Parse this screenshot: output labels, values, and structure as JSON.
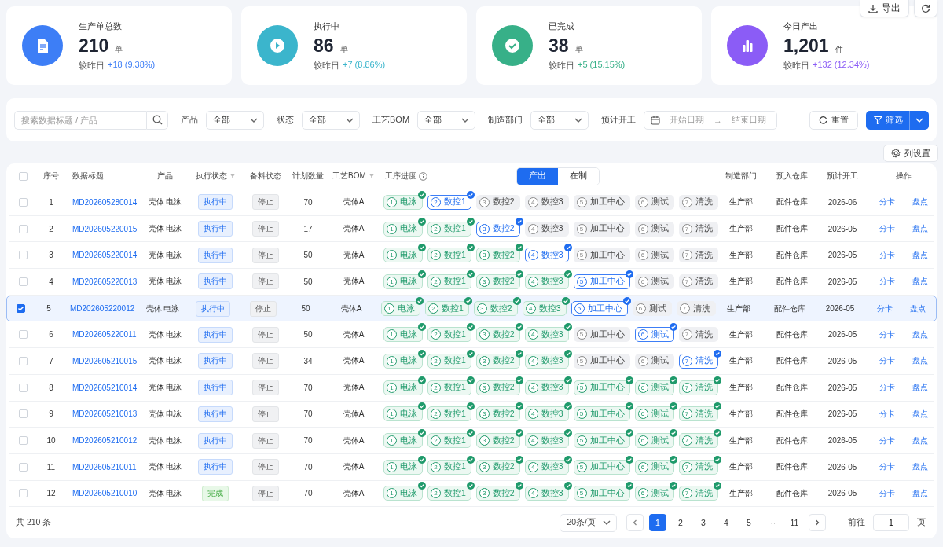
{
  "toolbar": {
    "export": "导出"
  },
  "stats": [
    {
      "label": "生产单总数",
      "value": "210",
      "unit": "单",
      "compare_label": "较昨日",
      "delta": "+18 (9.38%)",
      "color": "#3d7ef6",
      "kind": "document"
    },
    {
      "label": "执行中",
      "value": "86",
      "unit": "单",
      "compare_label": "较昨日",
      "delta": "+7 (8.86%)",
      "color": "#3bb5cc",
      "kind": "play"
    },
    {
      "label": "已完成",
      "value": "38",
      "unit": "单",
      "compare_label": "较昨日",
      "delta": "+5 (15.15%)",
      "color": "#37b088",
      "kind": "check"
    },
    {
      "label": "今日产出",
      "value": "1,201",
      "unit": "件",
      "compare_label": "较昨日",
      "delta": "+132 (12.34%)",
      "color": "#8b5cf6",
      "kind": "chart"
    }
  ],
  "filters": {
    "search": {
      "placeholder": "搜索数据标题 / 产品"
    },
    "selects": [
      {
        "label": "产品",
        "value": "全部"
      },
      {
        "label": "状态",
        "value": "全部"
      },
      {
        "label": "工艺BOM",
        "value": "全部"
      },
      {
        "label": "制造部门",
        "value": "全部"
      }
    ],
    "date": {
      "label": "预计开工",
      "start_placeholder": "开始日期",
      "arrow": "→",
      "end_placeholder": "结束日期"
    },
    "reset": "重置",
    "filter": "筛选"
  },
  "column_settings": "列设置",
  "table": {
    "all_checked": false,
    "columns": [
      {
        "label": "序号"
      },
      {
        "label": "数据标题"
      },
      {
        "label": "产品"
      },
      {
        "label": "执行状态",
        "kind": "filter"
      },
      {
        "label": "备料状态"
      },
      {
        "label": "计划数量"
      },
      {
        "label": "工艺BOM",
        "kind": "filter"
      },
      {
        "label": "工序进度",
        "kind": "info"
      },
      {
        "label": "制造部门"
      },
      {
        "label": "预入仓库"
      },
      {
        "label": "预计开工"
      },
      {
        "label": "操作"
      }
    ],
    "progress_tabs": [
      {
        "label": "产出",
        "selected": true
      },
      {
        "label": "在制",
        "selected": false
      }
    ],
    "rows": [
      {
        "selected": false,
        "no": "1",
        "title": "MD202605280014",
        "product": "壳体 电泳",
        "exec_status": {
          "label": "执行中",
          "kind": "running"
        },
        "material_status": "停止",
        "qty": "70",
        "bom": "壳体A",
        "steps": [
          {
            "no": "1",
            "label": "电泳",
            "kind": "done"
          },
          {
            "no": "2",
            "label": "数控1",
            "kind": "current"
          },
          {
            "no": "3",
            "label": "数控2",
            "kind": "pending"
          },
          {
            "no": "4",
            "label": "数控3",
            "kind": "pending"
          },
          {
            "no": "5",
            "label": "加工中心",
            "kind": "pending"
          },
          {
            "no": "6",
            "label": "测试",
            "kind": "pending"
          },
          {
            "no": "7",
            "label": "清洗",
            "kind": "pending"
          }
        ],
        "dept": "生产部",
        "warehouse": "配件仓库",
        "start": "2026-06",
        "actions": [
          "分卡",
          "盘点"
        ]
      },
      {
        "selected": false,
        "no": "2",
        "title": "MD202605220015",
        "product": "壳体 电泳",
        "exec_status": {
          "label": "执行中",
          "kind": "running"
        },
        "material_status": "停止",
        "qty": "17",
        "bom": "壳体A",
        "steps": [
          {
            "no": "1",
            "label": "电泳",
            "kind": "done"
          },
          {
            "no": "2",
            "label": "数控1",
            "kind": "done"
          },
          {
            "no": "3",
            "label": "数控2",
            "kind": "current"
          },
          {
            "no": "4",
            "label": "数控3",
            "kind": "pending"
          },
          {
            "no": "5",
            "label": "加工中心",
            "kind": "pending"
          },
          {
            "no": "6",
            "label": "测试",
            "kind": "pending"
          },
          {
            "no": "7",
            "label": "清洗",
            "kind": "pending"
          }
        ],
        "dept": "生产部",
        "warehouse": "配件仓库",
        "start": "2026-05",
        "actions": [
          "分卡",
          "盘点"
        ]
      },
      {
        "selected": false,
        "no": "3",
        "title": "MD202605220014",
        "product": "壳体 电泳",
        "exec_status": {
          "label": "执行中",
          "kind": "running"
        },
        "material_status": "停止",
        "qty": "50",
        "bom": "壳体A",
        "steps": [
          {
            "no": "1",
            "label": "电泳",
            "kind": "done"
          },
          {
            "no": "2",
            "label": "数控1",
            "kind": "done"
          },
          {
            "no": "3",
            "label": "数控2",
            "kind": "done"
          },
          {
            "no": "4",
            "label": "数控3",
            "kind": "current"
          },
          {
            "no": "5",
            "label": "加工中心",
            "kind": "pending"
          },
          {
            "no": "6",
            "label": "测试",
            "kind": "pending"
          },
          {
            "no": "7",
            "label": "清洗",
            "kind": "pending"
          }
        ],
        "dept": "生产部",
        "warehouse": "配件仓库",
        "start": "2026-05",
        "actions": [
          "分卡",
          "盘点"
        ]
      },
      {
        "selected": false,
        "no": "4",
        "title": "MD202605220013",
        "product": "壳体 电泳",
        "exec_status": {
          "label": "执行中",
          "kind": "running"
        },
        "material_status": "停止",
        "qty": "50",
        "bom": "壳体A",
        "steps": [
          {
            "no": "1",
            "label": "电泳",
            "kind": "done"
          },
          {
            "no": "2",
            "label": "数控1",
            "kind": "done"
          },
          {
            "no": "3",
            "label": "数控2",
            "kind": "done"
          },
          {
            "no": "4",
            "label": "数控3",
            "kind": "done"
          },
          {
            "no": "5",
            "label": "加工中心",
            "kind": "current"
          },
          {
            "no": "6",
            "label": "测试",
            "kind": "pending"
          },
          {
            "no": "7",
            "label": "清洗",
            "kind": "pending"
          }
        ],
        "dept": "生产部",
        "warehouse": "配件仓库",
        "start": "2026-05",
        "actions": [
          "分卡",
          "盘点"
        ]
      },
      {
        "selected": true,
        "no": "5",
        "title": "MD202605220012",
        "product": "壳体 电泳",
        "exec_status": {
          "label": "执行中",
          "kind": "running"
        },
        "material_status": "停止",
        "qty": "50",
        "bom": "壳体A",
        "steps": [
          {
            "no": "1",
            "label": "电泳",
            "kind": "done"
          },
          {
            "no": "2",
            "label": "数控1",
            "kind": "done"
          },
          {
            "no": "3",
            "label": "数控2",
            "kind": "done"
          },
          {
            "no": "4",
            "label": "数控3",
            "kind": "done"
          },
          {
            "no": "5",
            "label": "加工中心",
            "kind": "current"
          },
          {
            "no": "6",
            "label": "测试",
            "kind": "pending"
          },
          {
            "no": "7",
            "label": "清洗",
            "kind": "pending"
          }
        ],
        "dept": "生产部",
        "warehouse": "配件仓库",
        "start": "2026-05",
        "actions": [
          "分卡",
          "盘点"
        ]
      },
      {
        "selected": false,
        "no": "6",
        "title": "MD202605220011",
        "product": "壳体 电泳",
        "exec_status": {
          "label": "执行中",
          "kind": "running"
        },
        "material_status": "停止",
        "qty": "50",
        "bom": "壳体A",
        "steps": [
          {
            "no": "1",
            "label": "电泳",
            "kind": "done"
          },
          {
            "no": "2",
            "label": "数控1",
            "kind": "done"
          },
          {
            "no": "3",
            "label": "数控2",
            "kind": "done"
          },
          {
            "no": "4",
            "label": "数控3",
            "kind": "done"
          },
          {
            "no": "5",
            "label": "加工中心",
            "kind": "pending"
          },
          {
            "no": "6",
            "label": "测试",
            "kind": "current"
          },
          {
            "no": "7",
            "label": "清洗",
            "kind": "pending"
          }
        ],
        "dept": "生产部",
        "warehouse": "配件仓库",
        "start": "2026-05",
        "actions": [
          "分卡",
          "盘点"
        ]
      },
      {
        "selected": false,
        "no": "7",
        "title": "MD202605210015",
        "product": "壳体 电泳",
        "exec_status": {
          "label": "执行中",
          "kind": "running"
        },
        "material_status": "停止",
        "qty": "34",
        "bom": "壳体A",
        "steps": [
          {
            "no": "1",
            "label": "电泳",
            "kind": "done"
          },
          {
            "no": "2",
            "label": "数控1",
            "kind": "done"
          },
          {
            "no": "3",
            "label": "数控2",
            "kind": "done"
          },
          {
            "no": "4",
            "label": "数控3",
            "kind": "done"
          },
          {
            "no": "5",
            "label": "加工中心",
            "kind": "pending"
          },
          {
            "no": "6",
            "label": "测试",
            "kind": "pending"
          },
          {
            "no": "7",
            "label": "清洗",
            "kind": "current"
          }
        ],
        "dept": "生产部",
        "warehouse": "配件仓库",
        "start": "2026-05",
        "actions": [
          "分卡",
          "盘点"
        ]
      },
      {
        "selected": false,
        "no": "8",
        "title": "MD202605210014",
        "product": "壳体 电泳",
        "exec_status": {
          "label": "执行中",
          "kind": "running"
        },
        "material_status": "停止",
        "qty": "70",
        "bom": "壳体A",
        "steps": [
          {
            "no": "1",
            "label": "电泳",
            "kind": "done"
          },
          {
            "no": "2",
            "label": "数控1",
            "kind": "done"
          },
          {
            "no": "3",
            "label": "数控2",
            "kind": "done"
          },
          {
            "no": "4",
            "label": "数控3",
            "kind": "done"
          },
          {
            "no": "5",
            "label": "加工中心",
            "kind": "done"
          },
          {
            "no": "6",
            "label": "测试",
            "kind": "done"
          },
          {
            "no": "7",
            "label": "清洗",
            "kind": "done"
          }
        ],
        "dept": "生产部",
        "warehouse": "配件仓库",
        "start": "2026-05",
        "actions": [
          "分卡",
          "盘点"
        ]
      },
      {
        "selected": false,
        "no": "9",
        "title": "MD202605210013",
        "product": "壳体 电泳",
        "exec_status": {
          "label": "执行中",
          "kind": "running"
        },
        "material_status": "停止",
        "qty": "70",
        "bom": "壳体A",
        "steps": [
          {
            "no": "1",
            "label": "电泳",
            "kind": "done"
          },
          {
            "no": "2",
            "label": "数控1",
            "kind": "done"
          },
          {
            "no": "3",
            "label": "数控2",
            "kind": "done"
          },
          {
            "no": "4",
            "label": "数控3",
            "kind": "done"
          },
          {
            "no": "5",
            "label": "加工中心",
            "kind": "done"
          },
          {
            "no": "6",
            "label": "测试",
            "kind": "done"
          },
          {
            "no": "7",
            "label": "清洗",
            "kind": "done"
          }
        ],
        "dept": "生产部",
        "warehouse": "配件仓库",
        "start": "2026-05",
        "actions": [
          "分卡",
          "盘点"
        ]
      },
      {
        "selected": false,
        "no": "10",
        "title": "MD202605210012",
        "product": "壳体 电泳",
        "exec_status": {
          "label": "执行中",
          "kind": "running"
        },
        "material_status": "停止",
        "qty": "70",
        "bom": "壳体A",
        "steps": [
          {
            "no": "1",
            "label": "电泳",
            "kind": "done"
          },
          {
            "no": "2",
            "label": "数控1",
            "kind": "done"
          },
          {
            "no": "3",
            "label": "数控2",
            "kind": "done"
          },
          {
            "no": "4",
            "label": "数控3",
            "kind": "done"
          },
          {
            "no": "5",
            "label": "加工中心",
            "kind": "done"
          },
          {
            "no": "6",
            "label": "测试",
            "kind": "done"
          },
          {
            "no": "7",
            "label": "清洗",
            "kind": "done"
          }
        ],
        "dept": "生产部",
        "warehouse": "配件仓库",
        "start": "2026-05",
        "actions": [
          "分卡",
          "盘点"
        ]
      },
      {
        "selected": false,
        "no": "11",
        "title": "MD202605210011",
        "product": "壳体 电泳",
        "exec_status": {
          "label": "执行中",
          "kind": "running"
        },
        "material_status": "停止",
        "qty": "70",
        "bom": "壳体A",
        "steps": [
          {
            "no": "1",
            "label": "电泳",
            "kind": "done"
          },
          {
            "no": "2",
            "label": "数控1",
            "kind": "done"
          },
          {
            "no": "3",
            "label": "数控2",
            "kind": "done"
          },
          {
            "no": "4",
            "label": "数控3",
            "kind": "done"
          },
          {
            "no": "5",
            "label": "加工中心",
            "kind": "done"
          },
          {
            "no": "6",
            "label": "测试",
            "kind": "done"
          },
          {
            "no": "7",
            "label": "清洗",
            "kind": "done"
          }
        ],
        "dept": "生产部",
        "warehouse": "配件仓库",
        "start": "2026-05",
        "actions": [
          "分卡",
          "盘点"
        ]
      },
      {
        "selected": false,
        "no": "12",
        "title": "MD202605210010",
        "product": "壳体 电泳",
        "exec_status": {
          "label": "完成",
          "kind": "done"
        },
        "material_status": "停止",
        "qty": "70",
        "bom": "壳体A",
        "steps": [
          {
            "no": "1",
            "label": "电泳",
            "kind": "done"
          },
          {
            "no": "2",
            "label": "数控1",
            "kind": "done"
          },
          {
            "no": "3",
            "label": "数控2",
            "kind": "done"
          },
          {
            "no": "4",
            "label": "数控3",
            "kind": "done"
          },
          {
            "no": "5",
            "label": "加工中心",
            "kind": "done"
          },
          {
            "no": "6",
            "label": "测试",
            "kind": "done"
          },
          {
            "no": "7",
            "label": "清洗",
            "kind": "done"
          }
        ],
        "dept": "生产部",
        "warehouse": "配件仓库",
        "start": "2026-05",
        "actions": [
          "分卡",
          "盘点"
        ]
      }
    ]
  },
  "pager": {
    "total": "共 210 条",
    "page_size": "20条/页",
    "pages": [
      {
        "label": "1",
        "selected": true
      },
      {
        "label": "2",
        "selected": false
      },
      {
        "label": "3",
        "selected": false
      },
      {
        "label": "4",
        "selected": false
      },
      {
        "label": "5",
        "selected": false
      },
      {
        "label": "···",
        "selected": false
      },
      {
        "label": "11",
        "selected": false
      }
    ],
    "goto_label": "前往",
    "goto_value": "1",
    "page_unit": "页"
  }
}
